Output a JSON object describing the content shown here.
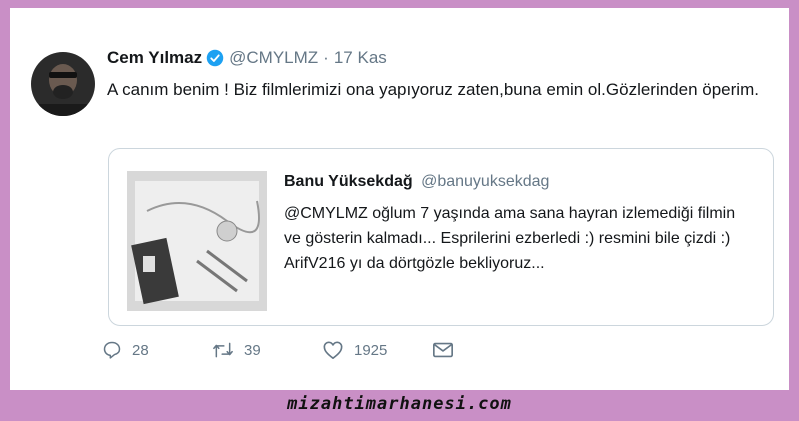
{
  "tweet": {
    "author_name": "Cem Yılmaz",
    "author_handle": "@CMYLMZ",
    "separator": "·",
    "date": "17 Kas",
    "text": "A canım benim ! Biz filmlerimizi ona yapıyoruz zaten,buna emin ol.Gözlerinden öperim.",
    "verified_icon": "verified-badge-icon"
  },
  "quoted_tweet": {
    "author_name": "Banu Yüksekdağ",
    "author_handle": "@banuyuksekdag",
    "text": "@CMYLMZ  oğlum 7 yaşında ama sana hayran izlemediği filmin ve gösterin kalmadı... Esprilerini ezberledi :) resmini bile çizdi :) ArifV216 yı da dörtgözle bekliyoruz..."
  },
  "actions": {
    "replies": "28",
    "retweets": "39",
    "likes": "1925"
  },
  "watermark": "mizahtimarhanesi.com",
  "colors": {
    "frame": "#c98fc6",
    "verified": "#1da1f2",
    "secondary_text": "#657786",
    "border": "#ccd6dd"
  }
}
